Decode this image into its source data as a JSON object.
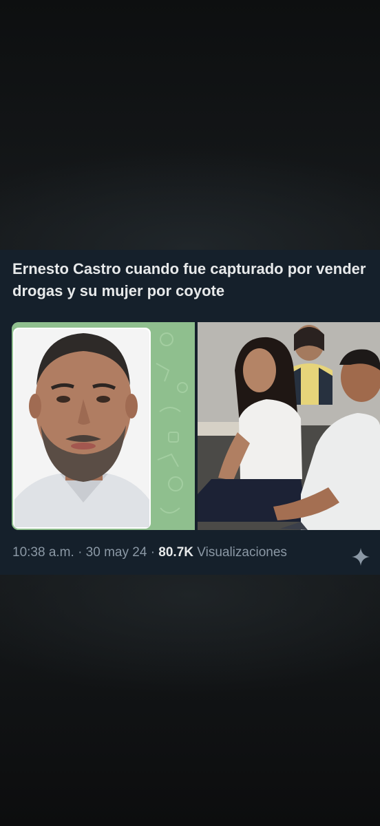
{
  "tweet": {
    "text": "Ernesto Castro cuando fue capturado por vender drogas y su mujer por coyote",
    "time": "10:38 a.m.",
    "separator": "·",
    "date": "30 may 24",
    "views_count": "80.7K",
    "views_label": "Visualizaciones"
  },
  "icons": {
    "grok": "sparkle-icon"
  },
  "colors": {
    "card_background": "#15202b",
    "text_primary": "#e7e9ea",
    "text_secondary": "#8b98a5"
  }
}
